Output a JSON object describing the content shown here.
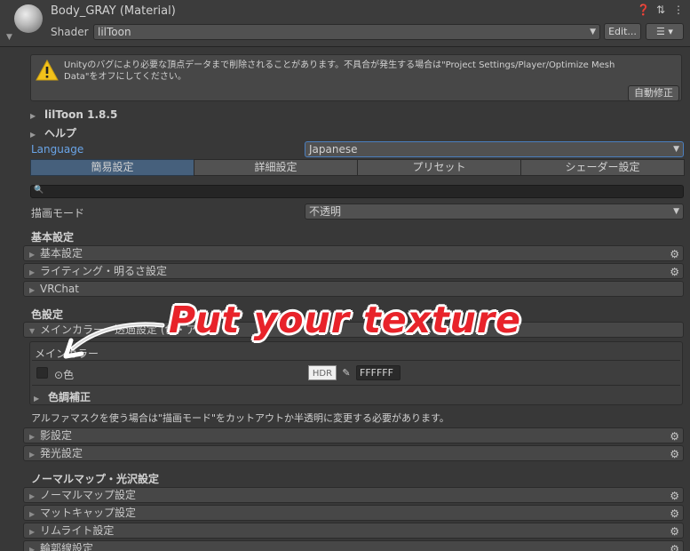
{
  "header": {
    "title": "Body_GRAY (Material)",
    "shader_label": "Shader",
    "shader_value": "lilToon",
    "edit_button": "Edit...",
    "icons": [
      "help-icon",
      "preset-icon",
      "more-icon"
    ]
  },
  "warning": {
    "text": "Unityのバグにより必要な頂点データまで削除されることがあります。不具合が発生する場合は\"Project Settings/Player/Optimize Mesh Data\"をオフにしてください。",
    "fix_button": "自動修正"
  },
  "folds": {
    "version": "lilToon 1.8.5",
    "help": "ヘルプ"
  },
  "language": {
    "label": "Language",
    "value": "Japanese"
  },
  "tabs": [
    {
      "label": "簡易設定",
      "active": true
    },
    {
      "label": "詳細設定",
      "active": false
    },
    {
      "label": "プリセット",
      "active": false
    },
    {
      "label": "シェーダー設定",
      "active": false
    }
  ],
  "search": {
    "placeholder": ""
  },
  "render_mode": {
    "label": "描画モード",
    "value": "不透明"
  },
  "sections": {
    "basic_title": "基本設定",
    "basic_items": [
      {
        "label": "基本設定",
        "gear": true
      },
      {
        "label": "ライティング・明るさ設定",
        "gear": true
      },
      {
        "label": "VRChat",
        "gear": false
      }
    ],
    "color_title": "色設定",
    "main_color_bar": "メインカラー・透過設定 (色・ア",
    "main_color_box_title": "メインカラー",
    "color_label": "色",
    "hdr_label": "HDR",
    "hex_value": "FFFFFF",
    "tone_label": "色調補正",
    "alpha_note": "アルファマスクを使う場合は\"描画モード\"をカットアウトか半透明に変更する必要があります。",
    "after_items": [
      {
        "label": "影設定",
        "gear": true
      },
      {
        "label": "発光設定",
        "gear": true
      }
    ],
    "normal_title": "ノーマルマップ・光沢設定",
    "normal_items": [
      {
        "label": "ノーマルマップ設定",
        "gear": true
      },
      {
        "label": "マットキャップ設定",
        "gear": true
      },
      {
        "label": "リムライト設定",
        "gear": true
      },
      {
        "label": "輪郭線設定",
        "gear": true
      }
    ]
  },
  "annotation": {
    "text": "Put your texture"
  },
  "colors": {
    "background": "#383838",
    "accent_blue": "#6aa5e8",
    "active_tab": "#46607c",
    "annotation_red": "#e8232a"
  }
}
